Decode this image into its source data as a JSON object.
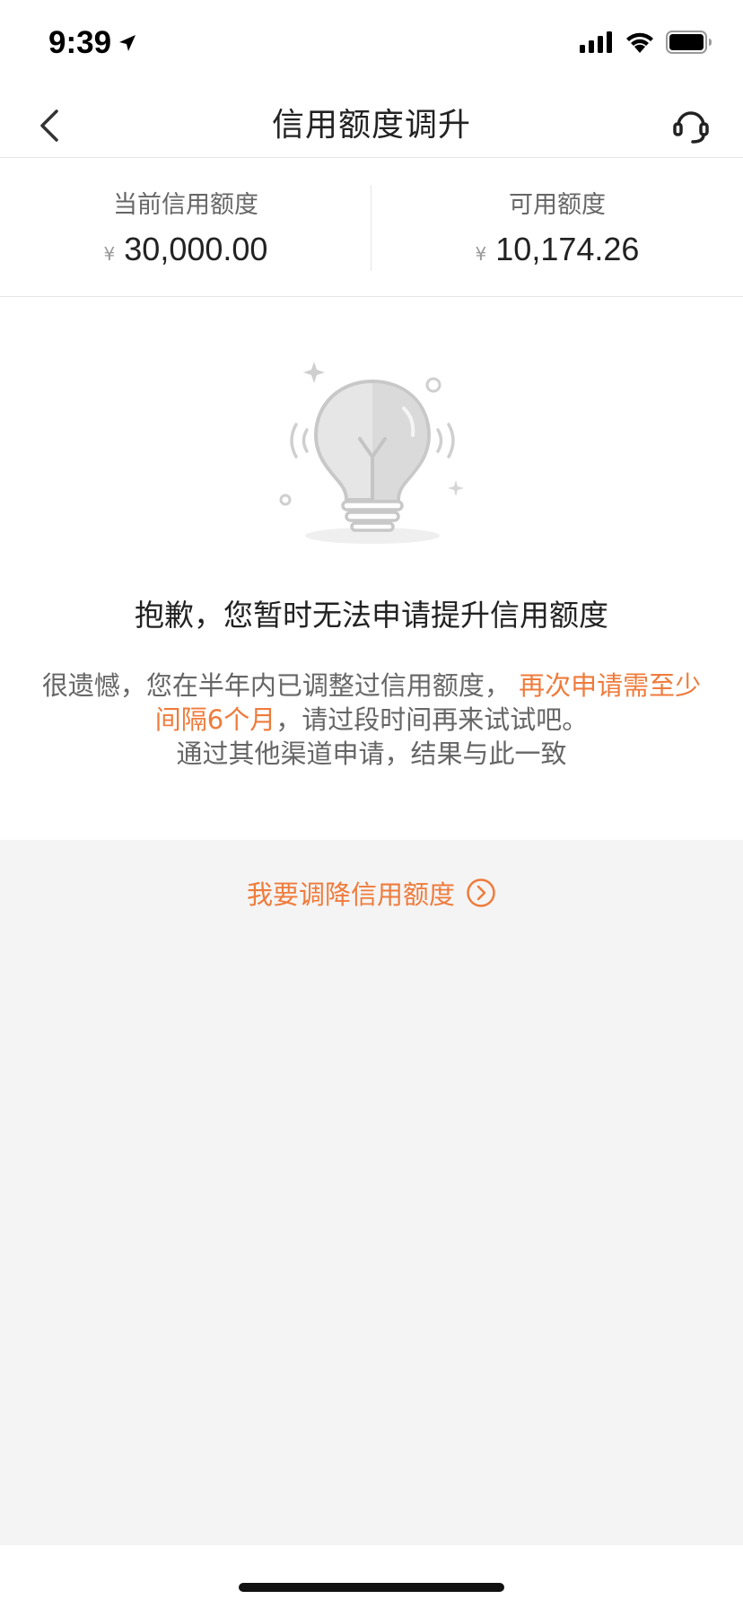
{
  "status_bar": {
    "time": "9:39"
  },
  "nav": {
    "title": "信用额度调升"
  },
  "summary": {
    "current": {
      "label": "当前信用额度",
      "currency": "¥",
      "amount": "30,000.00"
    },
    "available": {
      "label": "可用额度",
      "currency": "¥",
      "amount": "10,174.26"
    }
  },
  "message": {
    "title": "抱歉，您暂时无法申请提升信用额度",
    "body_part1": "很遗憾，您在半年内已调整过信用额度，",
    "body_highlight": "再次申请需至少间隔6个月",
    "body_part2": "，请过段时间再来试试吧。",
    "body_line3": "通过其他渠道申请，结果与此一致"
  },
  "actions": {
    "reduce_label": "我要调降信用额度"
  },
  "colors": {
    "accent": "#ef7b3b",
    "background_gray": "#f4f4f4"
  },
  "icons": [
    "back-arrow-icon",
    "customer-service-icon",
    "location-arrow-icon",
    "signal-icon",
    "wifi-icon",
    "battery-icon",
    "lightbulb-icon",
    "chevron-right-circle-icon"
  ]
}
